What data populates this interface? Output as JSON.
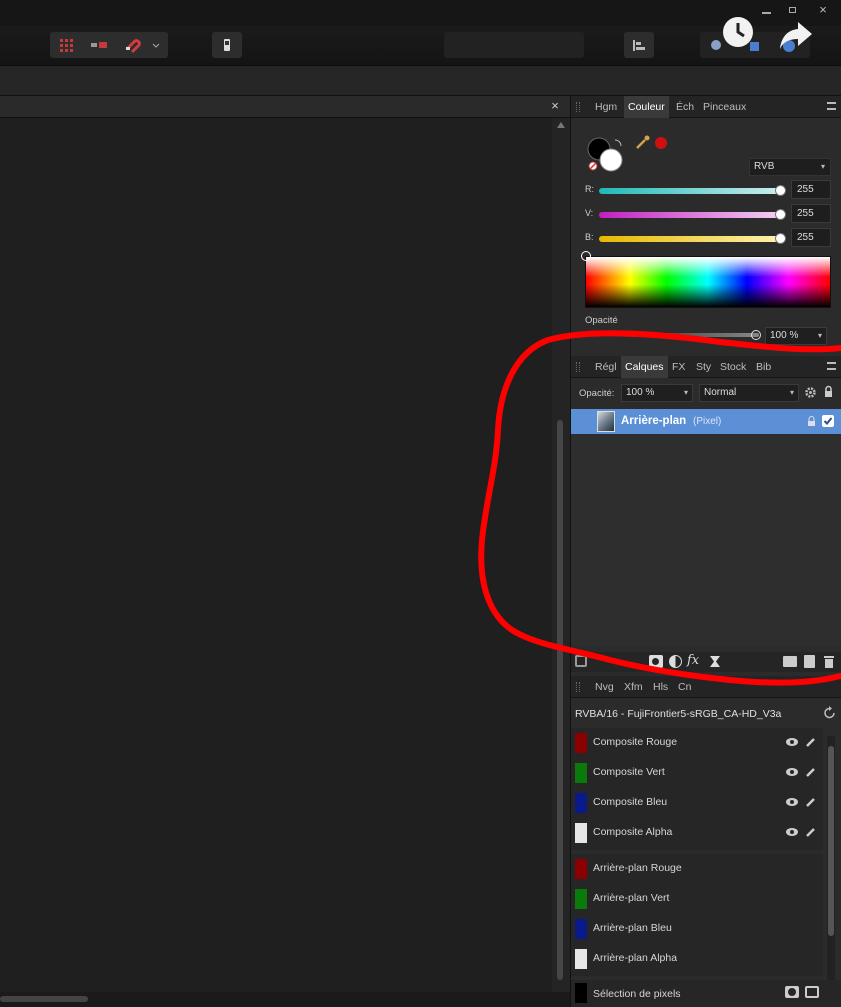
{
  "color_panel": {
    "tabs": [
      "Hgm",
      "Couleur",
      "Éch",
      "Pinceaux"
    ],
    "active_tab": "Couleur",
    "mode": "RVB",
    "sliders": [
      {
        "label": "R:",
        "value": "255"
      },
      {
        "label": "V:",
        "value": "255"
      },
      {
        "label": "B:",
        "value": "255"
      }
    ],
    "opacity_label": "Opacité",
    "opacity_value": "100 %"
  },
  "layers_panel": {
    "tabs": [
      "Régl",
      "Calques",
      "FX",
      "Sty",
      "Stock",
      "Bib"
    ],
    "active_tab": "Calques",
    "opacity_label": "Opacité:",
    "opacity_value": "100 %",
    "blend_mode": "Normal",
    "layer": {
      "name": "Arrière-plan",
      "type": "(Pixel)"
    },
    "footer_fx": "fx"
  },
  "channels_panel": {
    "tabs": [
      "Nvg",
      "Xfm",
      "Hls",
      "Cn"
    ],
    "profile": "RVBA/16 - FujiFrontier5-sRGB_CA-HD_V3a",
    "composite": [
      {
        "label": "Composite Rouge",
        "color": "#8b0000"
      },
      {
        "label": "Composite Vert",
        "color": "#0a7a0a"
      },
      {
        "label": "Composite Bleu",
        "color": "#0a1a8a"
      },
      {
        "label": "Composite Alpha",
        "color": "#e6e6e6"
      }
    ],
    "layer_channels": [
      {
        "label": "Arrière-plan Rouge",
        "color": "#8b0000"
      },
      {
        "label": "Arrière-plan Vert",
        "color": "#0a7a0a"
      },
      {
        "label": "Arrière-plan Bleu",
        "color": "#0a1a8a"
      },
      {
        "label": "Arrière-plan Alpha",
        "color": "#e6e6e6"
      }
    ],
    "selection": "Sélection de pixels"
  },
  "colors": {
    "accent_layer_selected": "#5b8fd6",
    "annotation_red": "#ff0000"
  }
}
